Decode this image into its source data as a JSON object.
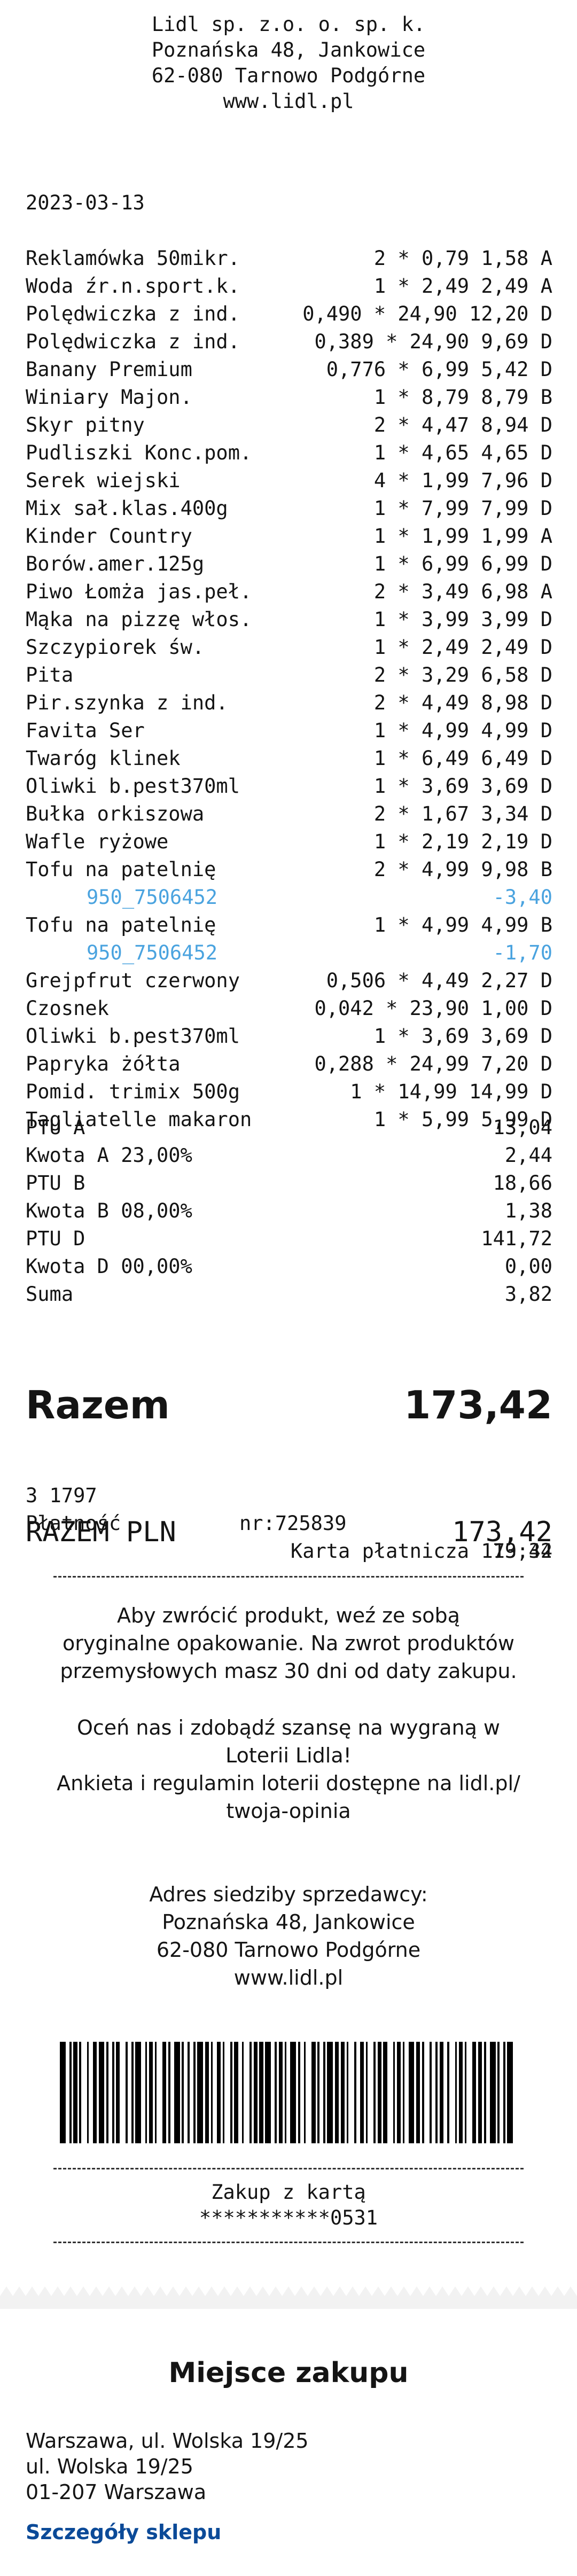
{
  "header": {
    "line1": "Lidl sp. z.o. o. sp. k.",
    "line2": "Poznańska 48, Jankowice",
    "line3": "62-080 Tarnowo Podgórne",
    "line4": "www.lidl.pl"
  },
  "date": "2023-03-13",
  "items": [
    {
      "name": "Reklamówka 50mikr.",
      "calc": "2 * 0,79 1,58 A",
      "discount": false
    },
    {
      "name": "Woda źr.n.sport.k.",
      "calc": "1 * 2,49 2,49 A",
      "discount": false
    },
    {
      "name": "Polędwiczka z ind.",
      "calc": "0,490 * 24,90 12,20 D",
      "discount": false
    },
    {
      "name": "Polędwiczka z ind.",
      "calc": "0,389 * 24,90 9,69 D",
      "discount": false
    },
    {
      "name": "Banany Premium",
      "calc": "0,776 * 6,99 5,42 D",
      "discount": false
    },
    {
      "name": "Winiary Majon.",
      "calc": "1 * 8,79 8,79 B",
      "discount": false
    },
    {
      "name": "Skyr pitny",
      "calc": "2 * 4,47 8,94 D",
      "discount": false
    },
    {
      "name": "Pudliszki Konc.pom.",
      "calc": "1 * 4,65 4,65 D",
      "discount": false
    },
    {
      "name": "Serek wiejski",
      "calc": "4 * 1,99 7,96 D",
      "discount": false
    },
    {
      "name": "Mix sał.klas.400g",
      "calc": "1 * 7,99 7,99 D",
      "discount": false
    },
    {
      "name": "Kinder Country",
      "calc": "1 * 1,99 1,99 A",
      "discount": false
    },
    {
      "name": "Borów.amer.125g",
      "calc": "1 * 6,99 6,99 D",
      "discount": false
    },
    {
      "name": "Piwo Łomża jas.peł.",
      "calc": "2 * 3,49 6,98 A",
      "discount": false
    },
    {
      "name": "Mąka na pizzę włos.",
      "calc": "1 * 3,99 3,99 D",
      "discount": false
    },
    {
      "name": "Szczypiorek św.",
      "calc": "1 * 2,49 2,49 D",
      "discount": false
    },
    {
      "name": "Pita",
      "calc": "2 * 3,29 6,58 D",
      "discount": false
    },
    {
      "name": "Pir.szynka z ind.",
      "calc": "2 * 4,49 8,98 D",
      "discount": false
    },
    {
      "name": "Favita Ser",
      "calc": "1 * 4,99 4,99 D",
      "discount": false
    },
    {
      "name": "Twaróg klinek",
      "calc": "1 * 6,49 6,49 D",
      "discount": false
    },
    {
      "name": "Oliwki b.pest370ml",
      "calc": "1 * 3,69 3,69 D",
      "discount": false
    },
    {
      "name": "Bułka orkiszowa",
      "calc": "2 * 1,67 3,34 D",
      "discount": false
    },
    {
      "name": "Wafle ryżowe",
      "calc": "1 * 2,19 2,19 D",
      "discount": false
    },
    {
      "name": "Tofu na patelnię",
      "calc": "2 * 4,99 9,98 B",
      "discount": false
    },
    {
      "name": "950_7506452",
      "calc": "-3,40",
      "discount": true
    },
    {
      "name": "Tofu na patelnię",
      "calc": "1 * 4,99 4,99 B",
      "discount": false
    },
    {
      "name": "950_7506452",
      "calc": "-1,70",
      "discount": true
    },
    {
      "name": "Grejpfrut czerwony",
      "calc": "0,506 * 4,49 2,27 D",
      "discount": false
    },
    {
      "name": "Czosnek",
      "calc": "0,042 * 23,90 1,00 D",
      "discount": false
    },
    {
      "name": "Oliwki b.pest370ml",
      "calc": "1 * 3,69 3,69 D",
      "discount": false
    },
    {
      "name": "Papryka żółta",
      "calc": "0,288 * 24,99 7,20 D",
      "discount": false
    },
    {
      "name": "Pomid. trimix 500g",
      "calc": "1 * 14,99 14,99 D",
      "discount": false
    },
    {
      "name": "Tagliatelle makaron",
      "calc": "1 * 5,99 5,99 D",
      "discount": false
    }
  ],
  "tax": [
    {
      "label": "PTU A",
      "value": "13,04"
    },
    {
      "label": "Kwota A 23,00%",
      "value": "2,44"
    },
    {
      "label": "PTU B",
      "value": "18,66"
    },
    {
      "label": "Kwota B 08,00%",
      "value": "1,38"
    },
    {
      "label": "PTU D",
      "value": "141,72"
    },
    {
      "label": "Kwota D 00,00%",
      "value": "0,00"
    },
    {
      "label": "Suma",
      "value": "3,82"
    }
  ],
  "total": {
    "label": "Razem",
    "value": "173,42"
  },
  "payment": {
    "store_no": "3 1797",
    "receipt_no": "nr:725839",
    "time": "19:34",
    "method_label": "Płatność",
    "method_value": "Karta płatnicza 173,42",
    "razem_pln_label": "RAZEM PLN",
    "razem_pln_value": "173,42"
  },
  "info": {
    "return1": "Aby zwrócić produkt, weź ze sobą",
    "return2": "oryginalne opakowanie. Na zwrot produktów",
    "return3": "przemysłowych masz 30 dni od daty zakupu.",
    "survey1": "Oceń nas i zdobądź szansę na wygraną w",
    "survey2": "Loterii Lidla!",
    "survey3": "Ankieta i regulamin loterii dostępne na lidl.pl/",
    "survey4": "twoja-opinia",
    "seller1": "Adres siedziby sprzedawcy:",
    "seller2": "Poznańska 48, Jankowice",
    "seller3": "62-080 Tarnowo Podgórne",
    "seller4": "www.lidl.pl"
  },
  "card": {
    "line1": "Zakup z kartą",
    "line2": "***********0531"
  },
  "place": {
    "title": "Miejsce zakupu",
    "addr1": "Warszawa, ul. Wolska 19/25",
    "addr2": "ul. Wolska 19/25",
    "addr3": "01-207 Warszawa",
    "details_link": "Szczegóły sklepu"
  },
  "colors": {
    "discount": "#4aa3df",
    "link": "#0b4a98"
  },
  "barcode_pattern": [
    3,
    2,
    1,
    1,
    2,
    1,
    1,
    3,
    1,
    2,
    2,
    1,
    3,
    1,
    1,
    2,
    1,
    1,
    2,
    3,
    1,
    2,
    1,
    1,
    3,
    2,
    1,
    1,
    2,
    1,
    1,
    3,
    2,
    1,
    1,
    2,
    3,
    1,
    1,
    2,
    1,
    2,
    1,
    1,
    3,
    1,
    2,
    1,
    1,
    2,
    2,
    1,
    1,
    3,
    1,
    1,
    2,
    2,
    1,
    3,
    1,
    1,
    2,
    1,
    2,
    1,
    3,
    2,
    1,
    1,
    2,
    1,
    1,
    2,
    3,
    1,
    1,
    2,
    1,
    3,
    2,
    1,
    1,
    2,
    1,
    1,
    3,
    1,
    2,
    1,
    2,
    1,
    1,
    3,
    1,
    2,
    2,
    1,
    1,
    3,
    1,
    1,
    2,
    1,
    2,
    3,
    1,
    1,
    2,
    1,
    1,
    2,
    3,
    1,
    2,
    1,
    1,
    3,
    1,
    2,
    1,
    1,
    2,
    2,
    1,
    3,
    1,
    1,
    2,
    1,
    1,
    3,
    2,
    1,
    2,
    1,
    1,
    2,
    3,
    1,
    1,
    2,
    1,
    1,
    3,
    2
  ]
}
